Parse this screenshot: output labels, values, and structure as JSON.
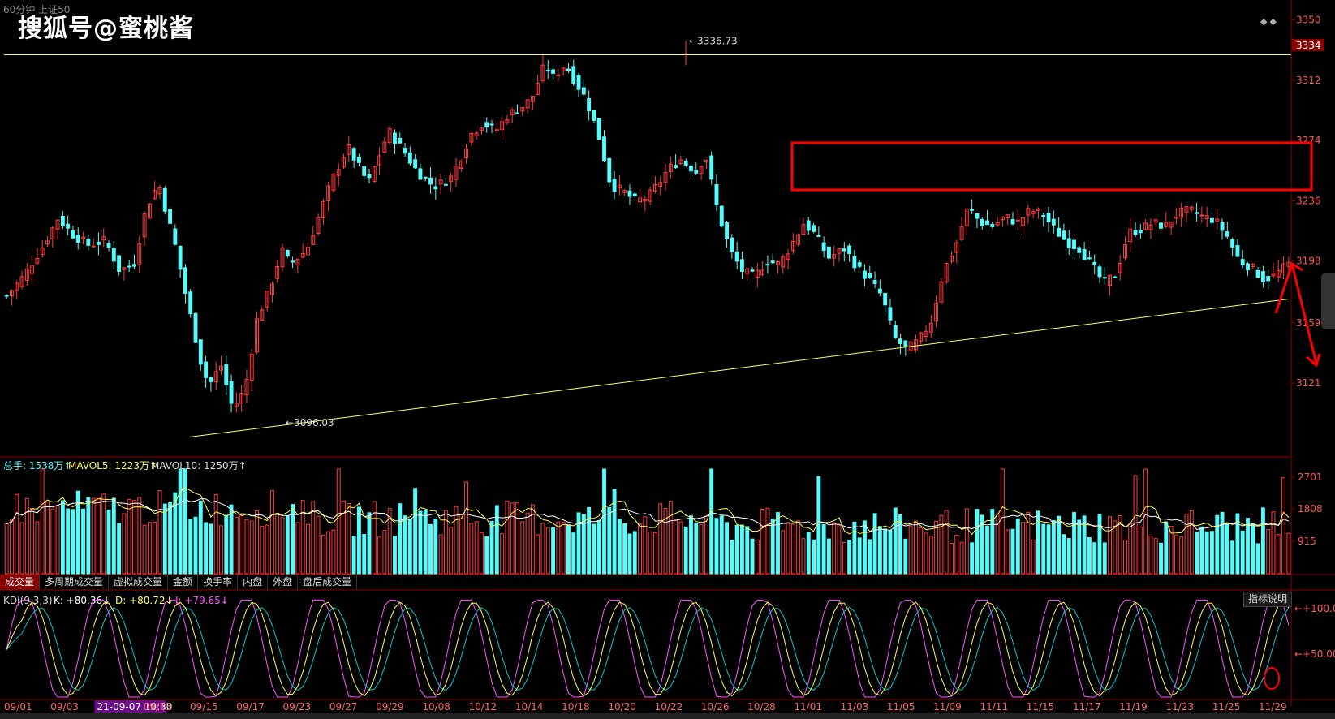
{
  "header": {
    "period_label": "60分钟 上证50",
    "watermark": "搜狐号@蜜桃酱"
  },
  "colors": {
    "up": "#ff3b3b",
    "down": "#54fcfc",
    "k": "#ffffff",
    "d": "#ffff55",
    "j": "#ff55ff",
    "mavol5": "#ffff55",
    "mavol10": "#ffffff",
    "trend": "#ffff66",
    "annot": "#ff0000"
  },
  "price_axis": {
    "ticks": [
      3350,
      3334,
      3312,
      3274,
      3236,
      3198,
      3159,
      3121
    ],
    "current_tag": "3334"
  },
  "annotations": {
    "high_label": "3336.73",
    "low_label": "3096.03"
  },
  "volume": {
    "labels": {
      "total": "总手: 1538万↑",
      "mavol5": "MAVOL5: 1223万↑",
      "mavol10": "MAVOL10: 1250万↑"
    },
    "axis_ticks": [
      "2701",
      "1808",
      "915"
    ]
  },
  "tabs": [
    "成交量",
    "多周期成交量",
    "虚拟成交量",
    "金额",
    "换手率",
    "内盘",
    "外盘",
    "盘后成交量"
  ],
  "kdj": {
    "labels": {
      "name": "KDJ(9,3,3)",
      "k": "K: +80.36↓",
      "d": "D: +80.72↓",
      "j": "J: +79.65↓"
    },
    "axis_ticks": [
      "+100.0",
      "+50.00"
    ],
    "help_button": "指标说明"
  },
  "date_axis": [
    "09/01",
    "09/03",
    "21-09-07 10:30",
    "09/13",
    "09/15",
    "09/17",
    "09/23",
    "09/27",
    "09/29",
    "10/08",
    "10/12",
    "10/14",
    "10/18",
    "10/20",
    "10/22",
    "10/26",
    "10/28",
    "11/01",
    "11/03",
    "11/05",
    "11/09",
    "11/11",
    "11/15",
    "11/17",
    "11/19",
    "11/23",
    "11/25",
    "11/29"
  ],
  "chart_data": {
    "type": "candlestick",
    "x_count": 252,
    "ylim": [
      3075,
      3360
    ],
    "horizontal_line": 3328,
    "high": {
      "value": 3336.73
    },
    "low": {
      "value": 3096.03
    },
    "trendline": {
      "from": [
        0,
        3087
      ],
      "to": [
        251,
        3174
      ]
    },
    "anchors": [
      [
        0,
        3176
      ],
      [
        8,
        3188
      ],
      [
        18,
        3208
      ],
      [
        25,
        3225
      ],
      [
        32,
        3215
      ],
      [
        40,
        3208
      ],
      [
        48,
        3211
      ],
      [
        55,
        3192
      ],
      [
        62,
        3196
      ],
      [
        68,
        3232
      ],
      [
        74,
        3247
      ],
      [
        82,
        3208
      ],
      [
        88,
        3172
      ],
      [
        96,
        3126
      ],
      [
        100,
        3121
      ],
      [
        104,
        3134
      ],
      [
        110,
        3105
      ],
      [
        116,
        3117
      ],
      [
        122,
        3162
      ],
      [
        128,
        3180
      ],
      [
        134,
        3205
      ],
      [
        138,
        3196
      ],
      [
        146,
        3205
      ],
      [
        158,
        3248
      ],
      [
        166,
        3270
      ],
      [
        176,
        3247
      ],
      [
        186,
        3280
      ],
      [
        194,
        3266
      ],
      [
        200,
        3254
      ],
      [
        208,
        3245
      ],
      [
        216,
        3250
      ],
      [
        222,
        3266
      ],
      [
        226,
        3278
      ],
      [
        232,
        3285
      ],
      [
        238,
        3280
      ],
      [
        244,
        3290
      ],
      [
        252,
        3296
      ],
      [
        256,
        3302
      ],
      [
        262,
        3322
      ],
      [
        266,
        3314
      ],
      [
        272,
        3322
      ],
      [
        276,
        3313
      ]
    ],
    "series_note": "price path reconstructed approximately",
    "tail_price": [
      3210,
      3192,
      3205,
      3180
    ]
  }
}
